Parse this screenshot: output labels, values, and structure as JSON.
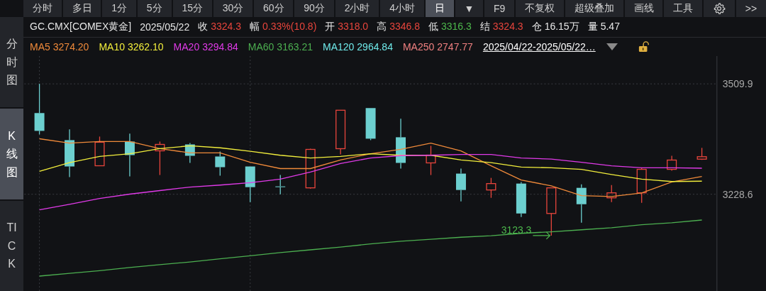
{
  "toolbar": {
    "tabs": [
      {
        "kind": "text",
        "label": "分时",
        "selected": false
      },
      {
        "kind": "text",
        "label": "多日",
        "selected": false
      },
      {
        "kind": "text",
        "label": "1分",
        "selected": false
      },
      {
        "kind": "text",
        "label": "5分",
        "selected": false
      },
      {
        "kind": "text",
        "label": "15分",
        "selected": false
      },
      {
        "kind": "text",
        "label": "30分",
        "selected": false
      },
      {
        "kind": "text",
        "label": "60分",
        "selected": false
      },
      {
        "kind": "text",
        "label": "90分",
        "selected": false
      },
      {
        "kind": "text",
        "label": "2小时",
        "selected": false
      },
      {
        "kind": "text",
        "label": "4小时",
        "selected": false
      },
      {
        "kind": "text",
        "label": "日",
        "selected": true
      },
      {
        "kind": "text",
        "label": "▼",
        "selected": false
      },
      {
        "kind": "text",
        "label": "F9",
        "selected": false
      },
      {
        "kind": "text",
        "label": "不复权",
        "selected": false
      },
      {
        "kind": "text",
        "label": "超级叠加",
        "selected": false
      },
      {
        "kind": "text",
        "label": "画线",
        "selected": false
      },
      {
        "kind": "text",
        "label": "工具",
        "selected": false
      },
      {
        "kind": "icon",
        "selected": false
      },
      {
        "kind": "text",
        "label": ">>",
        "selected": false
      }
    ]
  },
  "sidebar": {
    "tabs": [
      {
        "label": "分时图",
        "selected": false
      },
      {
        "label": "K线图",
        "selected": true
      },
      {
        "label": "TICK",
        "selected": false
      }
    ]
  },
  "quote": {
    "symbol": "GC.CMX[COMEX黄金]",
    "date": "2025/05/22",
    "fields": [
      {
        "label": "收",
        "value": "3324.3",
        "color": "#e8453c"
      },
      {
        "label": "幅",
        "value": "0.33%(10.8)",
        "color": "#e8453c"
      },
      {
        "label": "开",
        "value": "3318.0",
        "color": "#e8453c"
      },
      {
        "label": "高",
        "value": "3346.8",
        "color": "#e8453c"
      },
      {
        "label": "低",
        "value": "3316.3",
        "color": "#4cb84c"
      },
      {
        "label": "结",
        "value": "3324.3",
        "color": "#e8453c"
      },
      {
        "label": "仓",
        "value": "16.15万",
        "color": "#e6e6e6"
      },
      {
        "label": "量",
        "value": "5.47",
        "color": "#e6e6e6"
      }
    ]
  },
  "legend": {
    "items": [
      {
        "value": "3274.20"
      },
      {
        "value": "3262.10"
      },
      {
        "value": "3294.84"
      },
      {
        "value": "3163.21"
      },
      {
        "name": "MA120",
        "value": "2964.84",
        "color": "#6ee8e8"
      },
      {
        "name": "MA250",
        "value": "2747.77",
        "color": "#f08080"
      }
    ],
    "date_range": "2025/04/22-2025/05/22…",
    "locked": false
  },
  "chart": {
    "chart_data": {
      "type": "candlestick",
      "grid": true,
      "categories": [
        null,
        null,
        null,
        null,
        null,
        null,
        null,
        null,
        null,
        null,
        null,
        null,
        null,
        null,
        null,
        null,
        null,
        null,
        null,
        null,
        null,
        null,
        null
      ],
      "ylim": [
        2981.8,
        3580.7
      ],
      "yticks": [
        {
          "value": 3509.9,
          "label": "3509.9"
        },
        {
          "value": 3228.6,
          "label": "3228.6"
        }
      ],
      "ohlc": [
        [
          3435.5,
          3509.9,
          3381.0,
          3390.1
        ],
        [
          3366.5,
          3393.8,
          3272.2,
          3299.4
        ],
        [
          3301.2,
          3375.6,
          3301.2,
          3361.1
        ],
        [
          3362.9,
          3382.9,
          3274.0,
          3328.4
        ],
        [
          3339.3,
          3362.9,
          3277.6,
          3355.6
        ],
        [
          3355.6,
          3359.3,
          3308.5,
          3326.6
        ],
        [
          3324.8,
          3337.5,
          3275.8,
          3297.6
        ],
        [
          3299.4,
          3299.4,
          3208.6,
          3246.7
        ],
        [
          3248.6,
          3277.6,
          3228.6,
          3246.7
        ],
        [
          3244.9,
          3344.7,
          3243.1,
          3342.9
        ],
        [
          3344.7,
          3442.7,
          3330.2,
          3442.7
        ],
        [
          3448.2,
          3448.2,
          3366.5,
          3370.2
        ],
        [
          3373.8,
          3421.0,
          3293.9,
          3308.5
        ],
        [
          3308.5,
          3352.0,
          3277.6,
          3328.4
        ],
        [
          3281.2,
          3293.9,
          3210.5,
          3239.5
        ],
        [
          3239.5,
          3270.3,
          3219.5,
          3255.8
        ],
        [
          3255.8,
          3259.5,
          3170.5,
          3179.6
        ],
        [
          3179.6,
          3244.9,
          3123.3,
          3244.9
        ],
        [
          3244.9,
          3254.0,
          3156.0,
          3203.2
        ],
        [
          3219.5,
          3252.2,
          3208.6,
          3232.2
        ],
        [
          3232.2,
          3295.7,
          3206.8,
          3292.1
        ],
        [
          3292.1,
          3326.6,
          3288.5,
          3315.7
        ],
        [
          3318.0,
          3346.8,
          3316.3,
          3324.3
        ]
      ],
      "series": [
        {
          "name": "MA5",
          "type": "line",
          "color": "#f08a3a",
          "values": [
            3370,
            3359,
            3363,
            3363,
            3345,
            3334,
            3334,
            3310,
            3294,
            3294,
            3316,
            3332,
            3343,
            3359,
            3339,
            3301,
            3265,
            3250,
            3225,
            3223,
            3232,
            3260,
            3274
          ]
        },
        {
          "name": "MA10",
          "type": "line",
          "color": "#f2ee3c",
          "values": [
            3287,
            3309,
            3325,
            3332,
            3345,
            3352,
            3347,
            3338,
            3328,
            3321,
            3325,
            3332,
            3328,
            3328,
            3316,
            3309,
            3298,
            3296,
            3292,
            3279,
            3267,
            3261,
            3262
          ]
        },
        {
          "name": "MA20",
          "type": "line",
          "color": "#e03ae8",
          "values": [
            3189,
            3203,
            3218,
            3229,
            3238,
            3247,
            3252,
            3258,
            3267,
            3285,
            3307,
            3321,
            3327,
            3328,
            3330,
            3330,
            3321,
            3318,
            3310,
            3301,
            3296,
            3296,
            3295
          ]
        },
        {
          "name": "MA60",
          "type": "line",
          "color": "#4caf50",
          "values": [
            3020,
            3027,
            3034,
            3042,
            3049,
            3056,
            3064,
            3072,
            3080,
            3087,
            3094,
            3102,
            3109,
            3114,
            3119,
            3123,
            3129,
            3133,
            3138,
            3143,
            3151,
            3156,
            3163
          ]
        }
      ],
      "annotations": [
        "3123.3"
      ]
    }
  }
}
